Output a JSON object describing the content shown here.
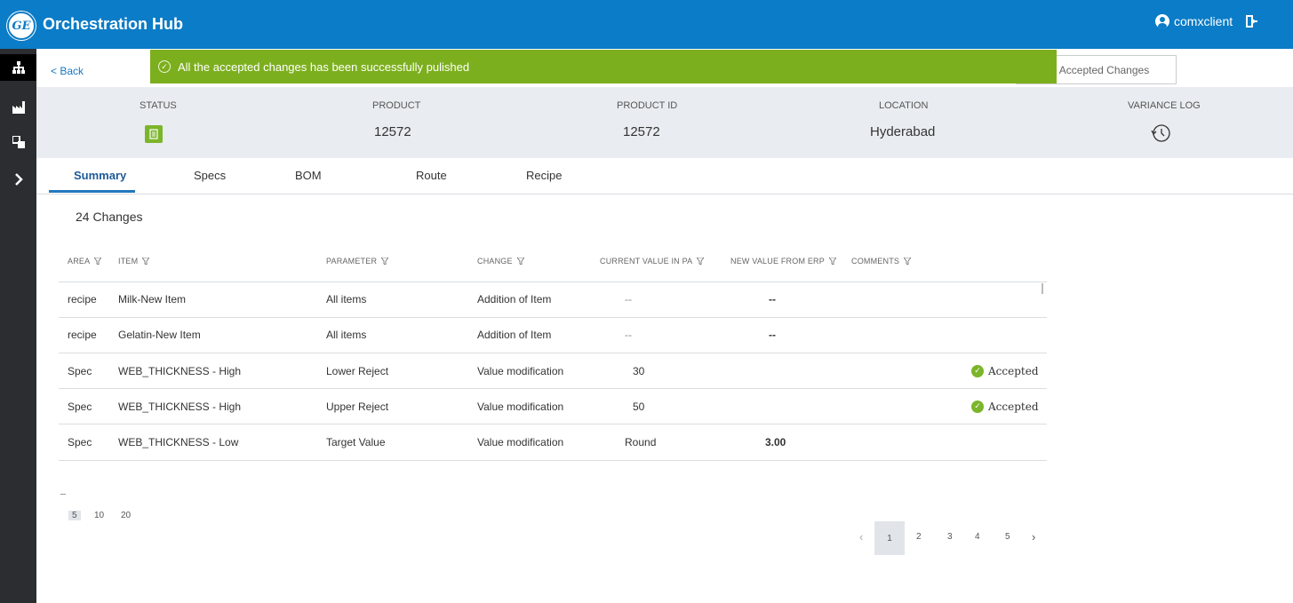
{
  "header": {
    "logo": "GE",
    "title": "Orchestration Hub",
    "username": "comxclient"
  },
  "sidebar": {
    "items": [
      "hierarchy-icon",
      "factory-icon",
      "layers-icon",
      "chevron-right-icon"
    ]
  },
  "back_label": "< Back",
  "publish_button_label": "ish Accepted Changes",
  "toast": {
    "message": "All the accepted changes has been successfully pulished",
    "color": "#7caf1d"
  },
  "info": {
    "status_label": "STATUS",
    "product_label": "PRODUCT",
    "product_value": "12572",
    "product_id_label": "PRODUCT ID",
    "product_id_value": "12572",
    "location_label": "LOCATION",
    "location_value": "Hyderabad",
    "variance_log_label": "VARIANCE LOG"
  },
  "tabs": [
    "Summary",
    "Specs",
    "BOM",
    "Route",
    "Recipe"
  ],
  "changes_count": "24 Changes",
  "table": {
    "headers": [
      "AREA",
      "ITEM",
      "PARAMETER",
      "CHANGE",
      "CURRENT VALUE IN PA",
      "NEW VALUE FROM ERP",
      "COMMENTS"
    ],
    "rows": [
      {
        "area": "recipe",
        "item": "Milk-New Item",
        "parameter": "All items",
        "change": "Addition of Item",
        "current": "--",
        "new": "--",
        "status": ""
      },
      {
        "area": "recipe",
        "item": "Gelatin-New Item",
        "parameter": "All items",
        "change": "Addition of Item",
        "current": "--",
        "new": "--",
        "status": ""
      },
      {
        "area": "Spec",
        "item": "WEB_THICKNESS - High",
        "parameter": "Lower Reject",
        "change": "Value modification",
        "current": "30",
        "new": "",
        "status": "Accepted"
      },
      {
        "area": "Spec",
        "item": "WEB_THICKNESS - High",
        "parameter": "Upper Reject",
        "change": "Value modification",
        "current": "50",
        "new": "",
        "status": "Accepted"
      },
      {
        "area": "Spec",
        "item": "WEB_THICKNESS - Low",
        "parameter": "Target Value",
        "change": "Value modification",
        "current": "Round",
        "new": "3.00",
        "status": ""
      }
    ]
  },
  "page_sizes": [
    "5",
    "10",
    "20"
  ],
  "pagination": {
    "prev": "‹",
    "pages": [
      "1",
      "2",
      "3",
      "4",
      "5"
    ],
    "next": "›",
    "current": "1"
  }
}
